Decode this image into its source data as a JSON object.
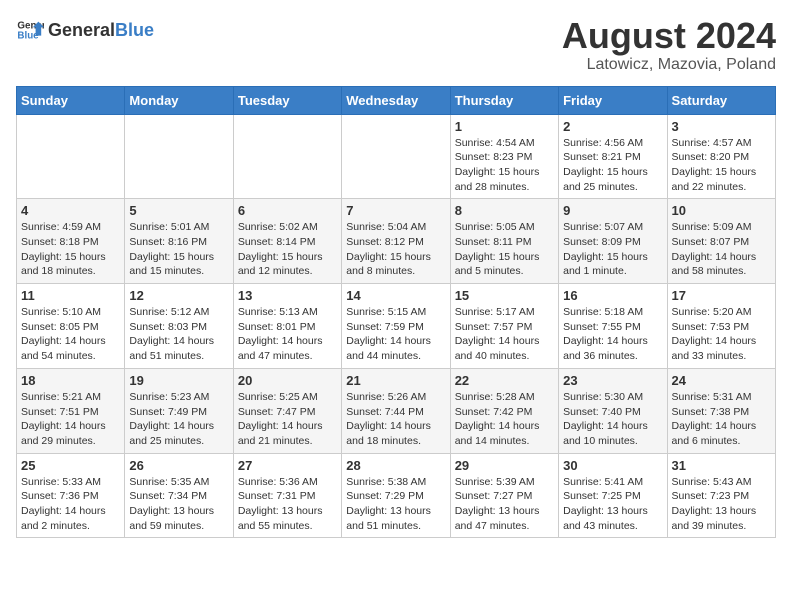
{
  "logo": {
    "general": "General",
    "blue": "Blue"
  },
  "title": "August 2024",
  "subtitle": "Latowicz, Mazovia, Poland",
  "days_of_week": [
    "Sunday",
    "Monday",
    "Tuesday",
    "Wednesday",
    "Thursday",
    "Friday",
    "Saturday"
  ],
  "weeks": [
    [
      {
        "day": "",
        "info": ""
      },
      {
        "day": "",
        "info": ""
      },
      {
        "day": "",
        "info": ""
      },
      {
        "day": "",
        "info": ""
      },
      {
        "day": "1",
        "info": "Sunrise: 4:54 AM\nSunset: 8:23 PM\nDaylight: 15 hours\nand 28 minutes."
      },
      {
        "day": "2",
        "info": "Sunrise: 4:56 AM\nSunset: 8:21 PM\nDaylight: 15 hours\nand 25 minutes."
      },
      {
        "day": "3",
        "info": "Sunrise: 4:57 AM\nSunset: 8:20 PM\nDaylight: 15 hours\nand 22 minutes."
      }
    ],
    [
      {
        "day": "4",
        "info": "Sunrise: 4:59 AM\nSunset: 8:18 PM\nDaylight: 15 hours\nand 18 minutes."
      },
      {
        "day": "5",
        "info": "Sunrise: 5:01 AM\nSunset: 8:16 PM\nDaylight: 15 hours\nand 15 minutes."
      },
      {
        "day": "6",
        "info": "Sunrise: 5:02 AM\nSunset: 8:14 PM\nDaylight: 15 hours\nand 12 minutes."
      },
      {
        "day": "7",
        "info": "Sunrise: 5:04 AM\nSunset: 8:12 PM\nDaylight: 15 hours\nand 8 minutes."
      },
      {
        "day": "8",
        "info": "Sunrise: 5:05 AM\nSunset: 8:11 PM\nDaylight: 15 hours\nand 5 minutes."
      },
      {
        "day": "9",
        "info": "Sunrise: 5:07 AM\nSunset: 8:09 PM\nDaylight: 15 hours\nand 1 minute."
      },
      {
        "day": "10",
        "info": "Sunrise: 5:09 AM\nSunset: 8:07 PM\nDaylight: 14 hours\nand 58 minutes."
      }
    ],
    [
      {
        "day": "11",
        "info": "Sunrise: 5:10 AM\nSunset: 8:05 PM\nDaylight: 14 hours\nand 54 minutes."
      },
      {
        "day": "12",
        "info": "Sunrise: 5:12 AM\nSunset: 8:03 PM\nDaylight: 14 hours\nand 51 minutes."
      },
      {
        "day": "13",
        "info": "Sunrise: 5:13 AM\nSunset: 8:01 PM\nDaylight: 14 hours\nand 47 minutes."
      },
      {
        "day": "14",
        "info": "Sunrise: 5:15 AM\nSunset: 7:59 PM\nDaylight: 14 hours\nand 44 minutes."
      },
      {
        "day": "15",
        "info": "Sunrise: 5:17 AM\nSunset: 7:57 PM\nDaylight: 14 hours\nand 40 minutes."
      },
      {
        "day": "16",
        "info": "Sunrise: 5:18 AM\nSunset: 7:55 PM\nDaylight: 14 hours\nand 36 minutes."
      },
      {
        "day": "17",
        "info": "Sunrise: 5:20 AM\nSunset: 7:53 PM\nDaylight: 14 hours\nand 33 minutes."
      }
    ],
    [
      {
        "day": "18",
        "info": "Sunrise: 5:21 AM\nSunset: 7:51 PM\nDaylight: 14 hours\nand 29 minutes."
      },
      {
        "day": "19",
        "info": "Sunrise: 5:23 AM\nSunset: 7:49 PM\nDaylight: 14 hours\nand 25 minutes."
      },
      {
        "day": "20",
        "info": "Sunrise: 5:25 AM\nSunset: 7:47 PM\nDaylight: 14 hours\nand 21 minutes."
      },
      {
        "day": "21",
        "info": "Sunrise: 5:26 AM\nSunset: 7:44 PM\nDaylight: 14 hours\nand 18 minutes."
      },
      {
        "day": "22",
        "info": "Sunrise: 5:28 AM\nSunset: 7:42 PM\nDaylight: 14 hours\nand 14 minutes."
      },
      {
        "day": "23",
        "info": "Sunrise: 5:30 AM\nSunset: 7:40 PM\nDaylight: 14 hours\nand 10 minutes."
      },
      {
        "day": "24",
        "info": "Sunrise: 5:31 AM\nSunset: 7:38 PM\nDaylight: 14 hours\nand 6 minutes."
      }
    ],
    [
      {
        "day": "25",
        "info": "Sunrise: 5:33 AM\nSunset: 7:36 PM\nDaylight: 14 hours\nand 2 minutes."
      },
      {
        "day": "26",
        "info": "Sunrise: 5:35 AM\nSunset: 7:34 PM\nDaylight: 13 hours\nand 59 minutes."
      },
      {
        "day": "27",
        "info": "Sunrise: 5:36 AM\nSunset: 7:31 PM\nDaylight: 13 hours\nand 55 minutes."
      },
      {
        "day": "28",
        "info": "Sunrise: 5:38 AM\nSunset: 7:29 PM\nDaylight: 13 hours\nand 51 minutes."
      },
      {
        "day": "29",
        "info": "Sunrise: 5:39 AM\nSunset: 7:27 PM\nDaylight: 13 hours\nand 47 minutes."
      },
      {
        "day": "30",
        "info": "Sunrise: 5:41 AM\nSunset: 7:25 PM\nDaylight: 13 hours\nand 43 minutes."
      },
      {
        "day": "31",
        "info": "Sunrise: 5:43 AM\nSunset: 7:23 PM\nDaylight: 13 hours\nand 39 minutes."
      }
    ]
  ]
}
